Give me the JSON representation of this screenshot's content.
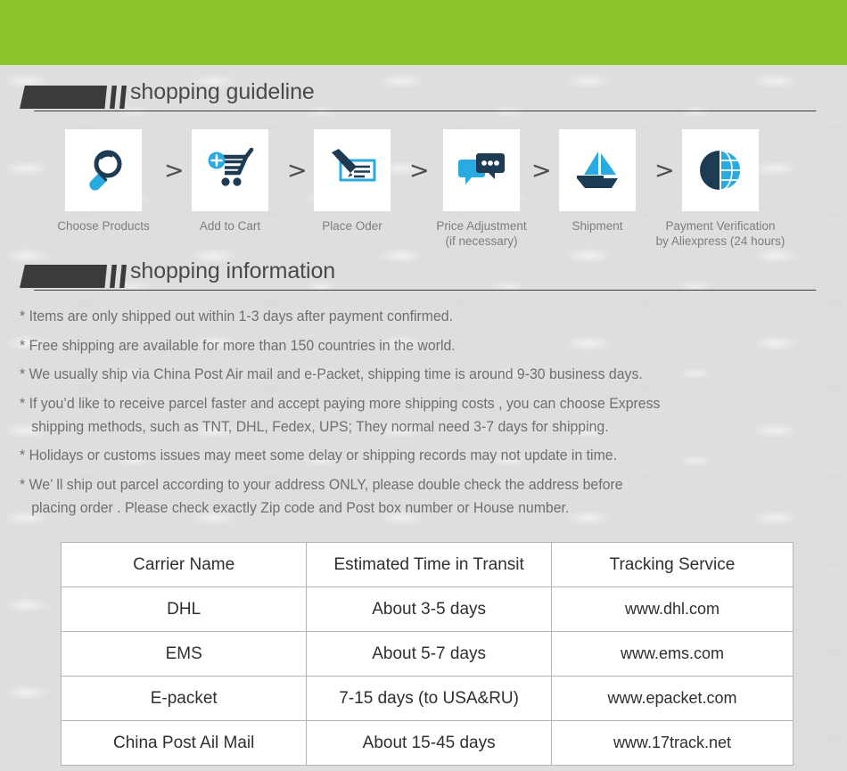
{
  "theme": {
    "banner_green": "#8cc42c",
    "page_background": "#dedede",
    "flag_dark": "#3b3b3b",
    "icon_dark_blue": "#1d3b53",
    "icon_light_blue": "#29aae1",
    "text_gray": "#6f6f6f",
    "heading_gray": "#4a4a4a",
    "table_border": "#b4b4b4"
  },
  "sections": {
    "guideline": {
      "title": "shopping guideline"
    },
    "information": {
      "title": "shopping information"
    }
  },
  "steps": [
    {
      "icon": "magnifier-icon",
      "label": "Choose Products"
    },
    {
      "icon": "shopping-cart-plus-icon",
      "label": "Add to Cart"
    },
    {
      "icon": "pen-check-document-icon",
      "label": "Place Oder"
    },
    {
      "icon": "chat-bubbles-icon",
      "label": "Price Adjustment\n(if necessary)"
    },
    {
      "icon": "sailboat-icon",
      "label": "Shipment"
    },
    {
      "icon": "dollar-globe-icon",
      "label": "Payment Verification\nby  Aliexpress (24 hours)"
    }
  ],
  "step_separator": ">",
  "info_lines": [
    "* Items are only shipped out within 1-3 days after payment confirmed.",
    "* Free shipping are available for more than 150 countries in the world.",
    "* We usually ship via China Post Air mail and e-Packet, shipping time is around 9-30 business days.",
    "* If you’d like to receive parcel faster and accept paying more shipping costs , you can choose Express",
    "   shipping methods, such as TNT, DHL, Fedex, UPS; They normal need 3-7 days for shipping.",
    "* Holidays or customs issues may meet some delay or shipping records may not update in time.",
    "* We’ ll ship out parcel according to your address ONLY, please double check the address before",
    "   placing order . Please check exactly Zip code and Post box number or House number."
  ],
  "carrier_table": {
    "headers": [
      "Carrier Name",
      "Estimated Time in Transit",
      "Tracking Service"
    ],
    "rows": [
      {
        "carrier": "DHL",
        "time": "About 3-5 days",
        "tracking": "www.dhl.com"
      },
      {
        "carrier": "EMS",
        "time": "About 5-7 days",
        "tracking": "www.ems.com"
      },
      {
        "carrier": "E-packet",
        "time": "7-15 days (to USA&RU)",
        "tracking": "www.epacket.com"
      },
      {
        "carrier": "China Post Ail Mail",
        "time": "About 15-45 days",
        "tracking": "www.17track.net"
      }
    ]
  }
}
